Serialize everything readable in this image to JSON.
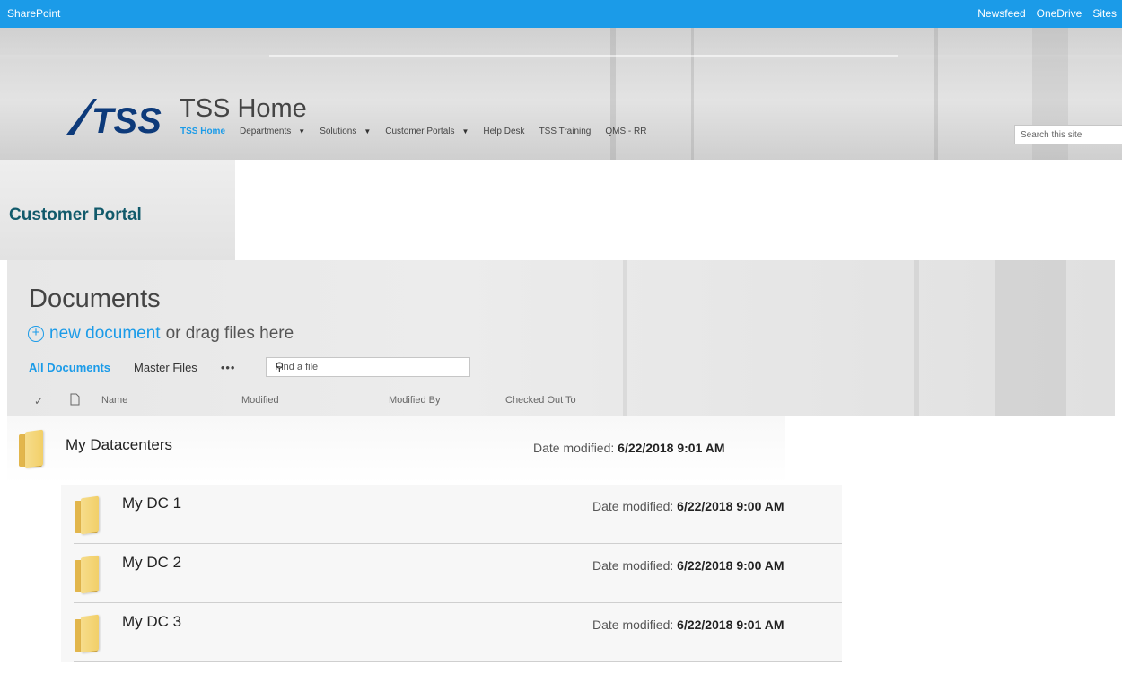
{
  "suitebar": {
    "brand": "SharePoint",
    "links": [
      "Newsfeed",
      "OneDrive",
      "Sites"
    ]
  },
  "header": {
    "logo_text": "TSS",
    "site_title": "TSS Home",
    "nav": [
      {
        "label": "TSS Home",
        "active": true,
        "dropdown": false
      },
      {
        "label": "Departments",
        "active": false,
        "dropdown": true
      },
      {
        "label": "Solutions",
        "active": false,
        "dropdown": true
      },
      {
        "label": "Customer Portals",
        "active": false,
        "dropdown": true
      },
      {
        "label": "Help Desk",
        "active": false,
        "dropdown": false
      },
      {
        "label": "TSS Training",
        "active": false,
        "dropdown": false
      },
      {
        "label": "QMS - RR",
        "active": false,
        "dropdown": false
      }
    ],
    "search_placeholder": "Search this site"
  },
  "portal": {
    "title": "Customer Portal"
  },
  "documents": {
    "title": "Documents",
    "new_link": "new document",
    "new_rest": "or drag files here",
    "views": {
      "all": "All Documents",
      "master": "Master Files",
      "more": "•••"
    },
    "find_placeholder": "Find a file",
    "columns": {
      "name": "Name",
      "modified": "Modified",
      "modified_by": "Modified By",
      "checked_out": "Checked Out To"
    }
  },
  "explorer": {
    "modified_label": "Date modified:",
    "folder": {
      "name": "My Datacenters",
      "modified": "6/22/2018 9:01 AM"
    },
    "items": [
      {
        "name": "My DC 1",
        "modified": "6/22/2018 9:00 AM"
      },
      {
        "name": "My DC 2",
        "modified": "6/22/2018 9:00 AM"
      },
      {
        "name": "My DC 3",
        "modified": "6/22/2018 9:01 AM"
      }
    ]
  },
  "colors": {
    "accent": "#1b9be8",
    "portal_title": "#115a6b",
    "folder": "#f2cf68"
  }
}
